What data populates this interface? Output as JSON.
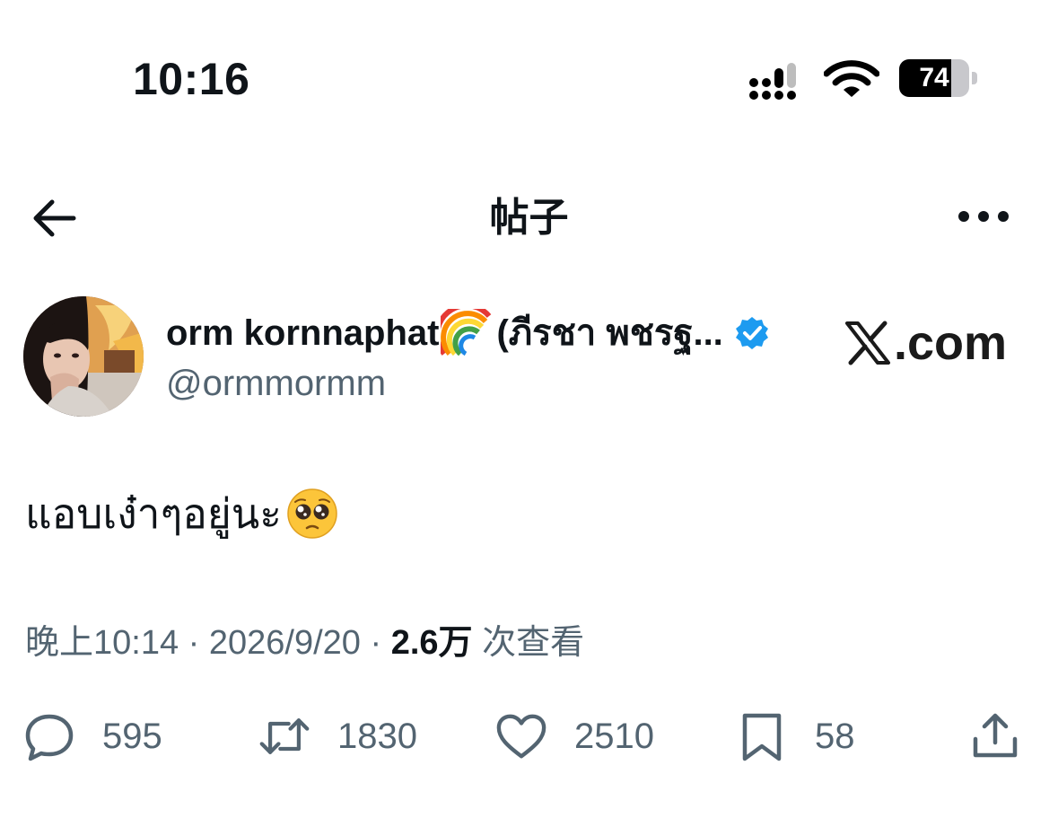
{
  "status_bar": {
    "time": "10:16",
    "battery_level": "74",
    "signal_icon": "cellular-signal-icon",
    "wifi_icon": "wifi-icon",
    "battery_icon": "battery-icon"
  },
  "nav": {
    "title": "帖子",
    "back_icon": "arrow-left-icon",
    "more_icon": "more-horizontal-icon"
  },
  "author": {
    "display_name": "orm kornnaphat",
    "display_name_suffix": "(ภีรชา พชรฐ...",
    "handle": "@ormmormm",
    "verified_color": "#1d9bf0"
  },
  "watermark": {
    "text": ".com",
    "logo_icon": "x-logo-icon"
  },
  "tweet": {
    "text": "แอบเง๋าๆอยู่นะ",
    "emoji_icon": "pleading-face-icon"
  },
  "meta": {
    "time": "晚上10:14",
    "separator": "·",
    "date": "2026/9/20",
    "views_count": "2.6万",
    "views_label": "次查看"
  },
  "actions": {
    "reply_count": "595",
    "retweet_count": "1830",
    "like_count": "2510",
    "bookmark_count": "58"
  },
  "colors": {
    "text_primary": "#0f1419",
    "text_secondary": "#536471",
    "accent": "#1d9bf0"
  }
}
